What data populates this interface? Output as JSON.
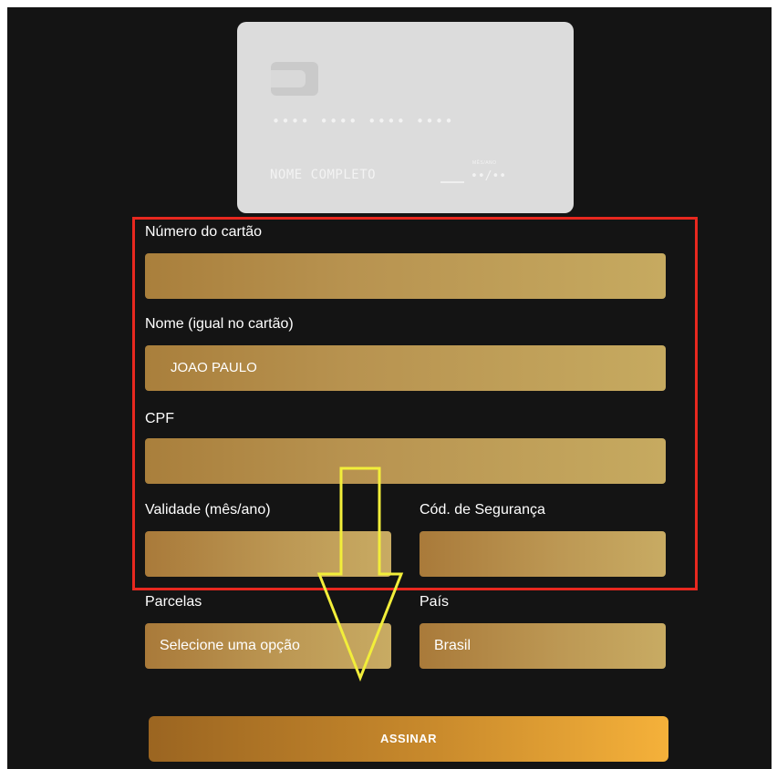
{
  "card_preview": {
    "number_mask": "•••• •••• •••• ••••",
    "name_placeholder": "NOME COMPLETO",
    "validity_label": "MÊS/ANO",
    "validity_mask": "••/••"
  },
  "form": {
    "card_number": {
      "label": "Número do cartão",
      "value": ""
    },
    "name": {
      "label": "Nome (igual no cartão)",
      "value": "JOAO PAULO"
    },
    "cpf": {
      "label": "CPF",
      "value": ""
    },
    "validity": {
      "label": "Validade (mês/ano)",
      "value": ""
    },
    "security_code": {
      "label": "Cód. de Segurança",
      "value": ""
    },
    "installments": {
      "label": "Parcelas",
      "selected": "Selecione uma opção"
    },
    "country": {
      "label": "País",
      "selected": "Brasil"
    }
  },
  "submit_label": "ASSINAR",
  "annotation_colors": {
    "highlight_box": "#e8281f",
    "arrow": "#f2ee3a"
  }
}
